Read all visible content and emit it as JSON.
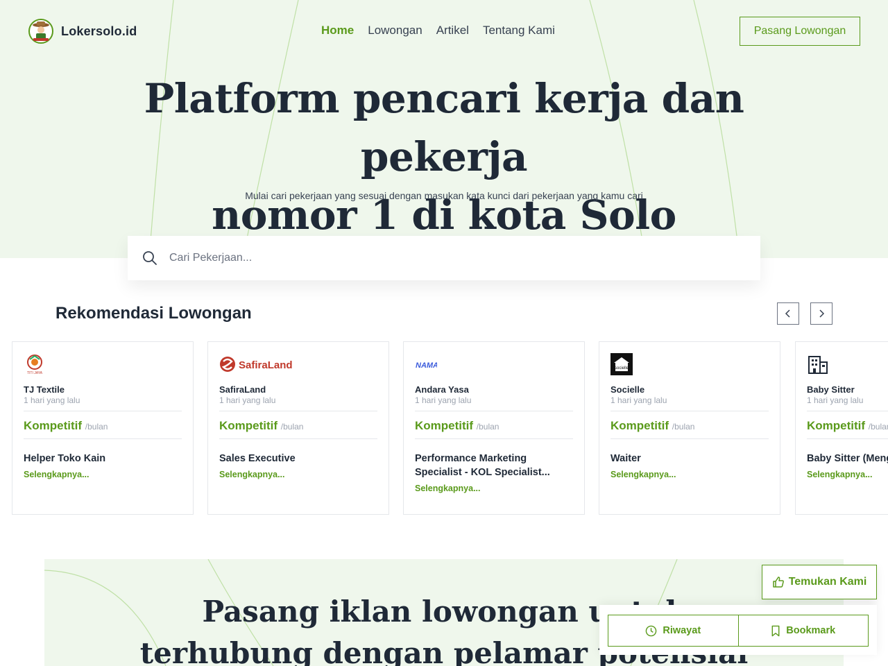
{
  "brand": {
    "name": "Lokersolo.id",
    "logo_icon": "farmer-mascot-icon"
  },
  "nav": {
    "items": [
      {
        "label": "Home",
        "active": true
      },
      {
        "label": "Lowongan",
        "active": false
      },
      {
        "label": "Artikel",
        "active": false
      },
      {
        "label": "Tentang Kami",
        "active": false
      }
    ],
    "post_button": "Pasang Lowongan"
  },
  "hero": {
    "title_line1": "Platform pencari kerja dan pekerja",
    "title_line2": "nomor 1 di kota Solo",
    "subtitle": "Mulai cari pekerjaan yang sesuai dengan masukan kata kunci dari pekerjaan yang kamu cari"
  },
  "search": {
    "placeholder": "Cari Pekerjaan...",
    "icon": "search-icon"
  },
  "recommendations": {
    "title": "Rekomendasi Lowongan",
    "prev_icon": "chevron-left-icon",
    "next_icon": "chevron-right-icon",
    "cards": [
      {
        "company": "TJ Textile",
        "time": "1 hari yang lalu",
        "salary": "Kompetitif",
        "salary_unit": "/bulan",
        "job": "Helper Toko Kain",
        "more": "Selengkapnya...",
        "logo_text": "TITI JAYA"
      },
      {
        "company": "SafiraLand",
        "time": "1 hari yang lalu",
        "salary": "Kompetitif",
        "salary_unit": "/bulan",
        "job": "Sales Executive",
        "more": "Selengkapnya...",
        "logo_text": "SafiraLand"
      },
      {
        "company": "Andara Yasa",
        "time": "1 hari yang lalu",
        "salary": "Kompetitif",
        "salary_unit": "/bulan",
        "job": "Performance Marketing Specialist - KOL Specialist...",
        "more": "Selengkapnya...",
        "logo_text": "NAMA"
      },
      {
        "company": "Socielle",
        "time": "1 hari yang lalu",
        "salary": "Kompetitif",
        "salary_unit": "/bulan",
        "job": "Waiter",
        "more": "Selengkapnya...",
        "logo_text": "socielle"
      },
      {
        "company": "Baby Sitter",
        "time": "1 hari yang lalu",
        "salary": "Kompetitif",
        "salary_unit": "/bulan",
        "job": "Baby Sitter (Meng",
        "more": "Selengkapnya...",
        "logo_text": ""
      }
    ]
  },
  "promo": {
    "title_line1": "Pasang iklan lowongan untuk",
    "title_line2": "terhubung dengan pelamar potensial"
  },
  "floating": {
    "find_us": "Temukan Kami",
    "find_us_icon": "thumbs-up-icon"
  },
  "bottom_bar": {
    "history": "Riwayat",
    "history_icon": "clock-icon",
    "bookmark": "Bookmark",
    "bookmark_icon": "bookmark-icon"
  },
  "colors": {
    "accent": "#5a9a1b",
    "hero_bg": "#eff7ec",
    "text": "#1f2937"
  }
}
